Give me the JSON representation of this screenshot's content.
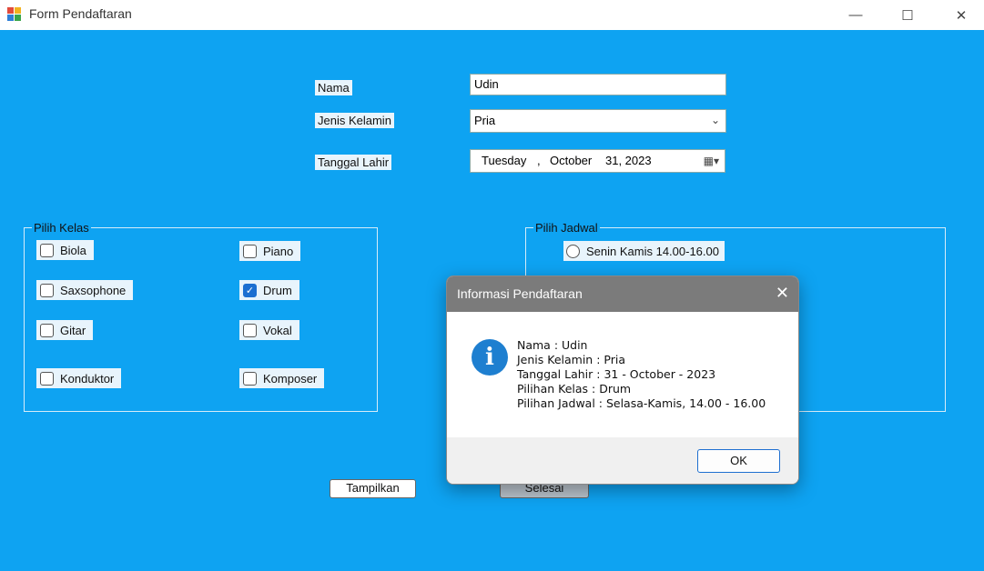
{
  "window": {
    "title": "Form Pendaftaran",
    "minimize_label": "—",
    "maximize_label": "☐",
    "close_label": "✕"
  },
  "form": {
    "nama_label": "Nama",
    "nama_value": "Udin",
    "jenis_kelamin_label": "Jenis Kelamin",
    "jenis_kelamin_value": "Pria",
    "tanggal_lahir_label": "Tanggal Lahir",
    "date_day": "Tuesday",
    "date_sep": ",",
    "date_month": "October",
    "date_rest": "31, 2023"
  },
  "kelas": {
    "title": "Pilih Kelas",
    "items": [
      {
        "label": "Biola",
        "checked": false
      },
      {
        "label": "Piano",
        "checked": false
      },
      {
        "label": "Saxsophone",
        "checked": false
      },
      {
        "label": "Drum",
        "checked": true
      },
      {
        "label": "Gitar",
        "checked": false
      },
      {
        "label": "Vokal",
        "checked": false
      },
      {
        "label": "Konduktor",
        "checked": false
      },
      {
        "label": "Komposer",
        "checked": false
      }
    ]
  },
  "jadwal": {
    "title": "Pilih Jadwal",
    "option_1": "Senin Kamis 14.00-16.00"
  },
  "buttons": {
    "tampilkan": "Tampilkan",
    "selesai": "Selesai"
  },
  "dialog": {
    "title": "Informasi Pendaftaran",
    "close_label": "✕",
    "icon_glyph": "i",
    "lines": [
      "Nama : Udin",
      "Jenis Kelamin : Pria",
      "Tanggal Lahir : 31 - October - 2023",
      "Pilihan Kelas : Drum",
      "Pilihan Jadwal : Selasa-Kamis, 14.00 - 16.00"
    ],
    "ok_label": "OK"
  },
  "colors": {
    "background": "#0ea3f2",
    "dialog_title": "#7b7b7b",
    "checked_accent": "#1b6fd1"
  }
}
